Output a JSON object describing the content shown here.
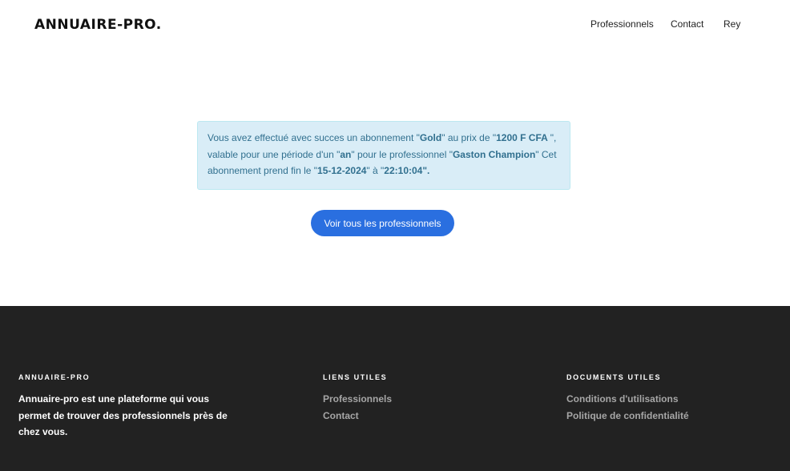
{
  "header": {
    "brand": "ANNUAIRE-PRO.",
    "nav": [
      "Professionnels",
      "Contact",
      "Rey"
    ]
  },
  "alert": {
    "t1": "Vous avez effectué avec succes un abonnement \"",
    "plan": "Gold",
    "t2": "\" au prix de \"",
    "price": "1200 F CFA ",
    "t3": "\", valable pour une période d'un \"",
    "period": "an",
    "t4": "\" pour le professionnel \"",
    "professional": "Gaston Champion",
    "t5": "\" Cet abonnement prend fin le \"",
    "end_date": "15-12-2024",
    "t6": "\" à \"",
    "end_time": "22:10:04\".",
    "color_bg": "#d9edf7",
    "color_text": "#31708f"
  },
  "cta": {
    "label": "Voir tous les professionnels",
    "color": "#2a6fe0"
  },
  "footer": {
    "col1": {
      "title": "ANNUAIRE-PRO",
      "description": "Annuaire-pro est une plateforme qui vous permet de trouver des professionnels près de chez vous."
    },
    "col2": {
      "title": "LIENS UTILES",
      "links": [
        "Professionnels",
        "Contact"
      ]
    },
    "col3": {
      "title": "DOCUMENTS UTILES",
      "links": [
        "Conditions d'utilisations",
        "Politique de confidentialité"
      ]
    },
    "color_bg": "#222222"
  }
}
